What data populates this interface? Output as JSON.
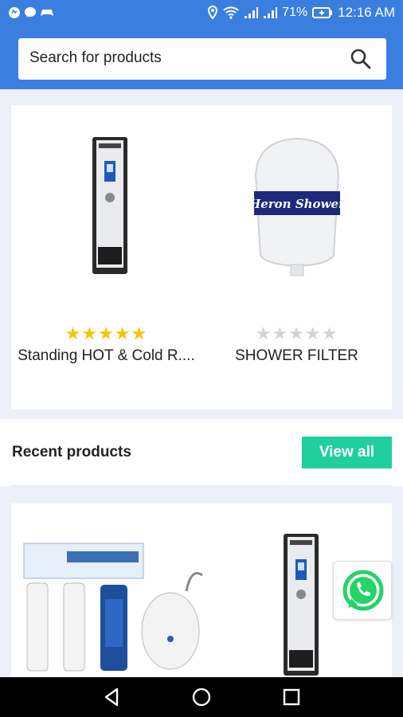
{
  "status_bar": {
    "battery": "71%",
    "time": "12:16 AM"
  },
  "search": {
    "placeholder": "Search for products"
  },
  "featured_products": [
    {
      "name": "Standing HOT & Cold R....",
      "rating": 5
    },
    {
      "name": "SHOWER FILTER",
      "rating": 0
    }
  ],
  "shower_brand": "Heron Shower",
  "recent": {
    "title": "Recent products",
    "view_all_label": "View all"
  },
  "colors": {
    "header": "#3a7ee0",
    "accent": "#1fcf9e",
    "star": "#f7c300",
    "whatsapp": "#25d366"
  }
}
